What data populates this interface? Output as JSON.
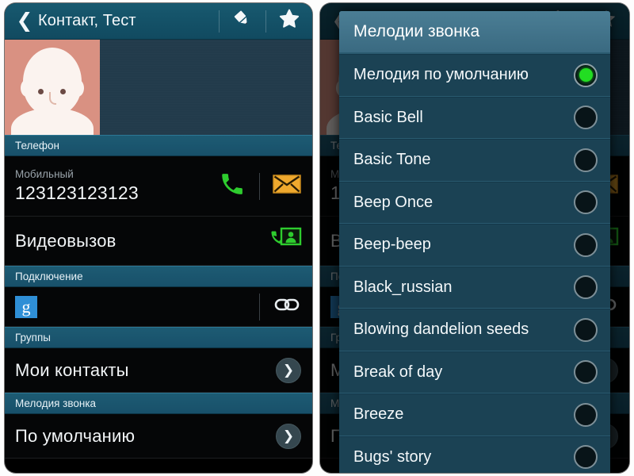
{
  "colors": {
    "actionbar": "#14536b",
    "section_header": "#1b586f",
    "row_bg": "#050607",
    "dialog_bg": "#1b4254",
    "dialog_header": "#43758c",
    "accent_green": "#22dd22",
    "phone_green": "#2ecc2e",
    "message_orange": "#f0a92e",
    "google_blue": "#2f8fd6",
    "avatar_peach": "#d99182"
  },
  "contact_screen": {
    "actionbar": {
      "back_icon": "chevron-left-icon",
      "title": "Контакт, Тест",
      "edit_icon": "pencil-icon",
      "favorite_icon": "star-icon"
    },
    "avatar_icon": "contact-avatar-placeholder",
    "sections": [
      {
        "header": "Телефон",
        "rows": [
          {
            "type": "phone",
            "label": "Мобильный",
            "value": "123123123123",
            "actions": [
              "call-icon",
              "message-icon"
            ]
          },
          {
            "type": "videocall",
            "value": "Видеовызов",
            "actions": [
              "video-call-icon"
            ]
          }
        ]
      },
      {
        "header": "Подключение",
        "rows": [
          {
            "type": "account",
            "value": "",
            "badge": "g",
            "actions": [
              "link-icon"
            ]
          }
        ]
      },
      {
        "header": "Группы",
        "rows": [
          {
            "type": "nav",
            "value": "Мои контакты",
            "actions": [
              "chevron-right-icon"
            ]
          }
        ]
      },
      {
        "header": "Мелодия звонка",
        "rows": [
          {
            "type": "nav",
            "value": "По умолчанию",
            "actions": [
              "chevron-right-icon"
            ]
          }
        ]
      }
    ]
  },
  "ringtone_dialog": {
    "title": "Мелодии звонка",
    "selected": "Мелодия по умолчанию",
    "options": [
      {
        "label": "Мелодия по умолчанию",
        "selected": true
      },
      {
        "label": "Basic Bell",
        "selected": false
      },
      {
        "label": "Basic Tone",
        "selected": false
      },
      {
        "label": "Beep Once",
        "selected": false
      },
      {
        "label": "Beep-beep",
        "selected": false
      },
      {
        "label": "Black_russian",
        "selected": false
      },
      {
        "label": "Blowing dandelion seeds",
        "selected": false
      },
      {
        "label": "Break of day",
        "selected": false
      },
      {
        "label": "Breeze",
        "selected": false
      },
      {
        "label": "Bugs' story",
        "selected": false
      }
    ]
  }
}
